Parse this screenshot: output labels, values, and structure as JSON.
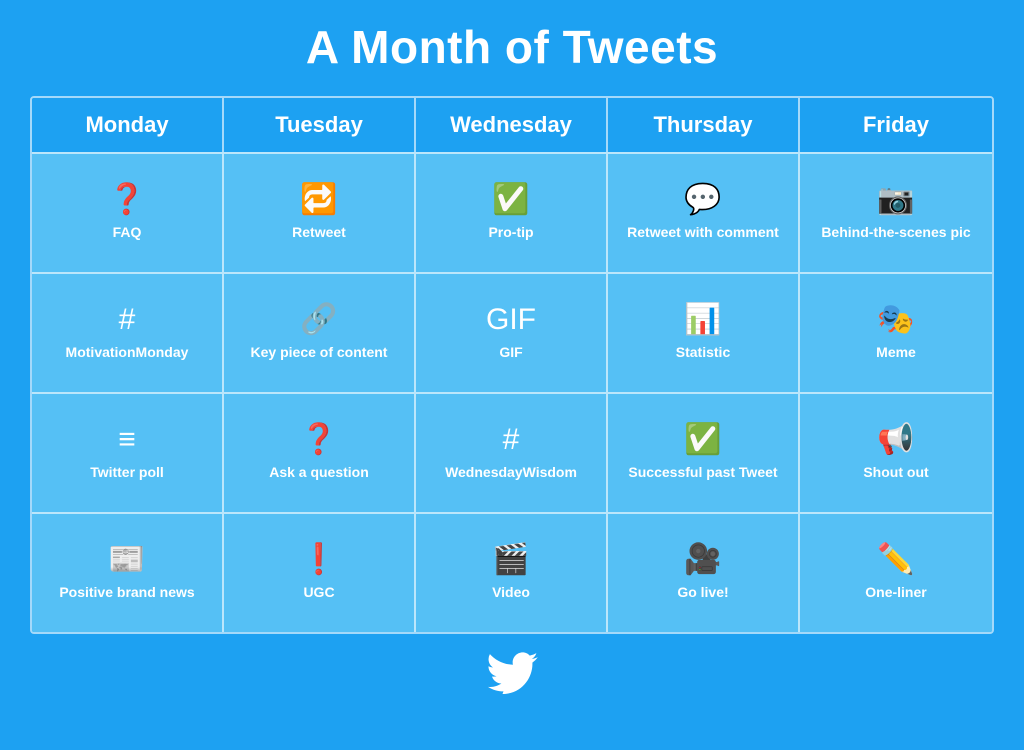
{
  "title": "A Month of Tweets",
  "colors": {
    "background": "#1DA1F2",
    "cell_bg": "#55C0F5",
    "text": "#ffffff",
    "border": "rgba(255,255,255,0.6)"
  },
  "days": [
    {
      "label": "Monday"
    },
    {
      "label": "Tuesday"
    },
    {
      "label": "Wednesday"
    },
    {
      "label": "Thursday"
    },
    {
      "label": "Friday"
    }
  ],
  "rows": [
    [
      {
        "icon": "❓",
        "label": "FAQ",
        "icon_name": "faq-icon"
      },
      {
        "icon": "🔁",
        "label": "Retweet",
        "icon_name": "retweet-icon"
      },
      {
        "icon": "✅",
        "label": "Pro-tip",
        "icon_name": "protip-icon"
      },
      {
        "icon": "💬",
        "label": "Retweet with comment",
        "icon_name": "retweet-comment-icon"
      },
      {
        "icon": "📷",
        "label": "Behind-the-scenes pic",
        "icon_name": "camera-icon"
      }
    ],
    [
      {
        "icon": "#",
        "label": "MotivationMonday",
        "icon_name": "hashtag-icon"
      },
      {
        "icon": "🔗",
        "label": "Key piece of content",
        "icon_name": "link-icon"
      },
      {
        "icon": "GIF",
        "label": "GIF",
        "icon_name": "gif-icon"
      },
      {
        "icon": "📊",
        "label": "Statistic",
        "icon_name": "statistic-icon"
      },
      {
        "icon": "🎭",
        "label": "Meme",
        "icon_name": "meme-icon"
      }
    ],
    [
      {
        "icon": "≡",
        "label": "Twitter poll",
        "icon_name": "poll-icon"
      },
      {
        "icon": "❓",
        "label": "Ask a question",
        "icon_name": "question-icon"
      },
      {
        "icon": "#",
        "label": "WednesdayWisdom",
        "icon_name": "hashtag2-icon"
      },
      {
        "icon": "✅",
        "label": "Successful past Tweet",
        "icon_name": "success-icon"
      },
      {
        "icon": "📢",
        "label": "Shout out",
        "icon_name": "shoutout-icon"
      }
    ],
    [
      {
        "icon": "📰",
        "label": "Positive brand news",
        "icon_name": "news-icon"
      },
      {
        "icon": "❗",
        "label": "UGC",
        "icon_name": "ugc-icon"
      },
      {
        "icon": "🎬",
        "label": "Video",
        "icon_name": "video-icon"
      },
      {
        "icon": "🎥",
        "label": "Go live!",
        "icon_name": "live-icon"
      },
      {
        "icon": "✏️",
        "label": "One-liner",
        "icon_name": "oneliner-icon"
      }
    ]
  ],
  "footer": {
    "icon_name": "twitter-bird-icon"
  }
}
